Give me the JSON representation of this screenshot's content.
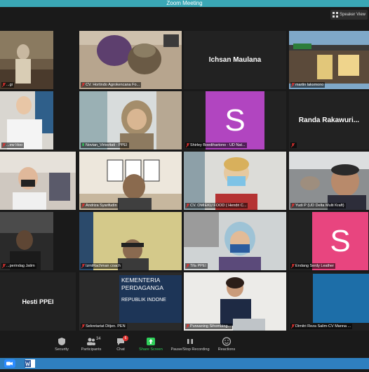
{
  "window": {
    "title": "Zoom Meeting"
  },
  "view": {
    "label": "Speaker View"
  },
  "participants": [
    {
      "name": "...gi",
      "kind": "video",
      "mic": "muted"
    },
    {
      "name": "CV. Hortindo Agrokencana Fo...",
      "kind": "video",
      "mic": "muted"
    },
    {
      "name": "Ichsan Maulana",
      "kind": "name",
      "mic": "none"
    },
    {
      "name": "martin laksmono",
      "kind": "video",
      "mic": "muted"
    },
    {
      "name": "...ew Hoo",
      "kind": "video",
      "mic": "muted"
    },
    {
      "name": "Novian_Virisvitati - PPEI",
      "kind": "video",
      "mic": "on",
      "active": true
    },
    {
      "name": "Shirley Boedihartono - UD Nat...",
      "kind": "avatar",
      "letter": "S",
      "color": "#b145c0",
      "mic": "muted"
    },
    {
      "name": "Randa  Rakawuri...",
      "kind": "name",
      "mic": "muted"
    },
    {
      "name": "...",
      "kind": "video",
      "mic": "none"
    },
    {
      "name": "Andriza Syarifudin",
      "kind": "video",
      "mic": "muted"
    },
    {
      "name": "CV. OMIEKU FOOD ( Hendri C...",
      "kind": "video",
      "mic": "muted"
    },
    {
      "name": "Yudi P (UD Delta Multi Kraft)",
      "kind": "video",
      "mic": "muted"
    },
    {
      "name": "...perindag Jatim",
      "kind": "video",
      "mic": "muted"
    },
    {
      "name": "IzmiRachman coach",
      "kind": "video",
      "mic": "muted"
    },
    {
      "name": "Tifa PPEI",
      "kind": "video",
      "mic": "muted"
    },
    {
      "name": "Endang Serdy Leather",
      "kind": "avatar",
      "letter": "S",
      "color": "#e8457f",
      "mic": "muted"
    },
    {
      "name": "Hesti PPEI",
      "kind": "name",
      "mic": "none"
    },
    {
      "name": "Sekretariat Ditjen. PEN",
      "kind": "slide",
      "mic": "muted",
      "slide_lines": [
        "KEMENTERIA",
        "PERDAGANGA",
        "REPUBLIK INDONE"
      ]
    },
    {
      "name": "Purwaning Sihombing...",
      "kind": "video",
      "mic": "muted"
    },
    {
      "name": "Dimitri Reza Salim-CV Manna ...",
      "kind": "video",
      "mic": "muted"
    }
  ],
  "toolbar": {
    "security": "Security",
    "participants": "Participants",
    "participants_count": "34",
    "chat": "Chat",
    "chat_badge": "6",
    "share": "Share Screen",
    "record": "Pause/Stop Recording",
    "reactions": "Reactions"
  },
  "colors": {
    "accent_green": "#2fd05a",
    "titlebar": "#3aa7b5",
    "active_border": "#c9d92a"
  }
}
